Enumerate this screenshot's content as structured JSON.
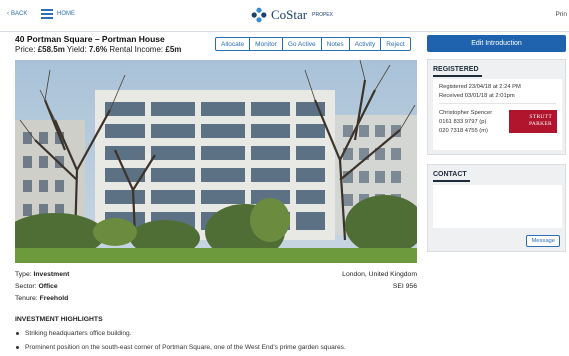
{
  "topbar": {
    "back_label": "BACK",
    "home_label": "HOME",
    "brand": "CoStar",
    "product": "PROPEX",
    "print_label": "Prin"
  },
  "property": {
    "title": "40 Portman Square – Portman House",
    "price_label": "Price:",
    "price_value": "£58.5m",
    "yield_label": "Yield:",
    "yield_value": "7.6%",
    "income_label": "Rental Income:",
    "income_value": "£5m"
  },
  "actions": [
    "Allocate",
    "Monitor",
    "Go Active",
    "Notes",
    "Activity",
    "Reject"
  ],
  "details": {
    "type_label": "Type:",
    "type_value": "Investment",
    "sector_label": "Sector:",
    "sector_value": "Office",
    "tenure_label": "Tenure:",
    "tenure_value": "Freehold",
    "location": "London, United Kingdom",
    "ref": "SEI 956"
  },
  "highlights": {
    "title": "INVESTMENT HIGHLIGHTS",
    "items": [
      "Striking headquarters office building.",
      "Prominent position on the south-east corner of Portman Square, one of the West End's prime garden squares."
    ]
  },
  "sidebar": {
    "edit_label": "Edit Introduction",
    "registered": {
      "heading": "REGISTERED",
      "registered_on": "Registered 23/04/18 at 2:24 PM",
      "received_on": "Received 03/01/18 at 2:01pm",
      "agent_name": "Christopher Spencer",
      "phone_p": "0161 833 9797 (p)",
      "phone_m": "020 7318 4755 (m)",
      "agency_logo_top": "STRUTT",
      "agency_logo_bottom": "PARKER"
    },
    "contact": {
      "heading": "CONTACT",
      "message_label": "Message"
    }
  },
  "colors": {
    "accent": "#2a6fb6",
    "primary_button": "#1f63ae",
    "agency_red": "#b0152d"
  }
}
